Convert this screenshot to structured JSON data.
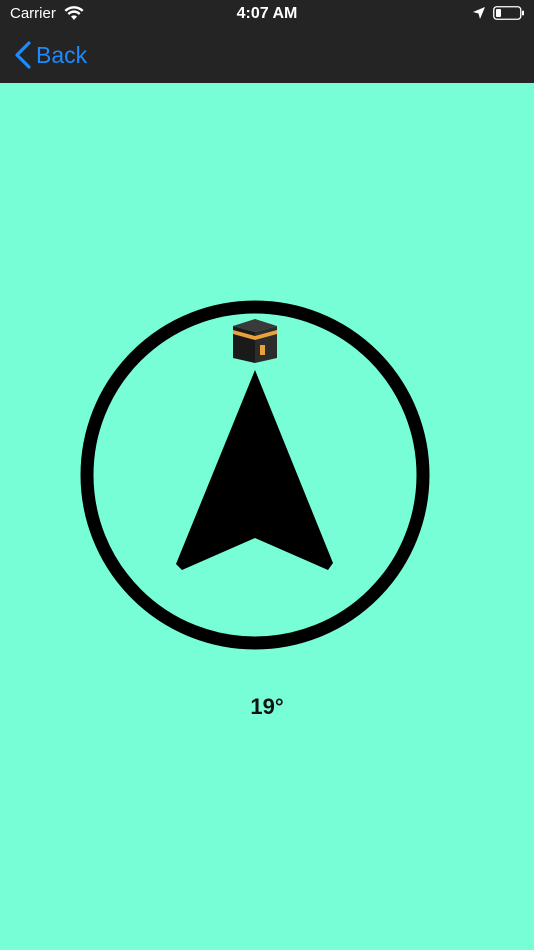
{
  "status_bar": {
    "carrier": "Carrier",
    "time": "4:07 AM",
    "icons": [
      "wifi-icon",
      "location-arrow-icon",
      "battery-icon"
    ]
  },
  "nav": {
    "back_label": "Back",
    "back_icon": "chevron-left-icon"
  },
  "compass": {
    "heading_text": "19°",
    "target_icon": "kaaba-icon",
    "pointer_icon": "arrow-pointer-icon"
  },
  "colors": {
    "background": "#77fed6",
    "header": "#242424",
    "accent": "#1a8cff",
    "kaaba_band": "#e8a23a"
  }
}
